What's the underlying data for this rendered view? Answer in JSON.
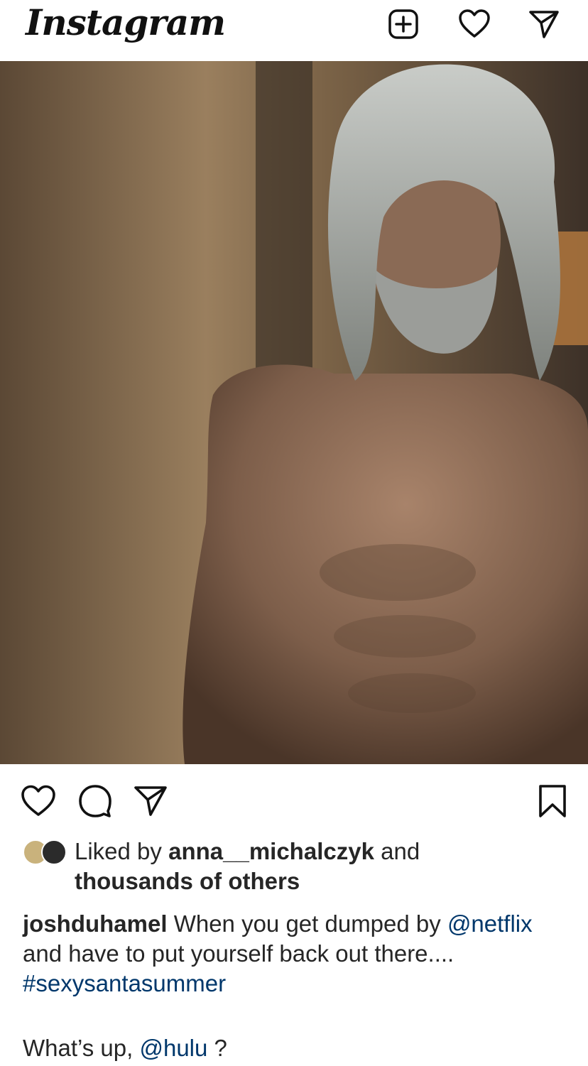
{
  "header": {
    "logo_text": "Instagram",
    "icons": [
      "new-post-icon",
      "heart-icon",
      "direct-message-icon"
    ]
  },
  "post": {
    "image_description_icon": "photo",
    "actions": [
      "like-icon",
      "comment-icon",
      "share-icon",
      "bookmark-icon"
    ],
    "likes": {
      "prefix": "Liked by",
      "user": "anna__michalczyk",
      "conj": "and",
      "others": "thousands of others"
    },
    "caption": {
      "username": "joshduhamel",
      "text1": " When you get dumped by ",
      "mention1": "@netflix",
      "text2": " and have to put yourself back out there.... ",
      "hashtag": "#sexysantasummer",
      "line2_prefix": "What’s up, ",
      "mention2": "@hulu",
      "line2_suffix": " ?"
    }
  },
  "colors": {
    "link": "#00376b",
    "text": "#262626",
    "background": "#ffffff"
  }
}
